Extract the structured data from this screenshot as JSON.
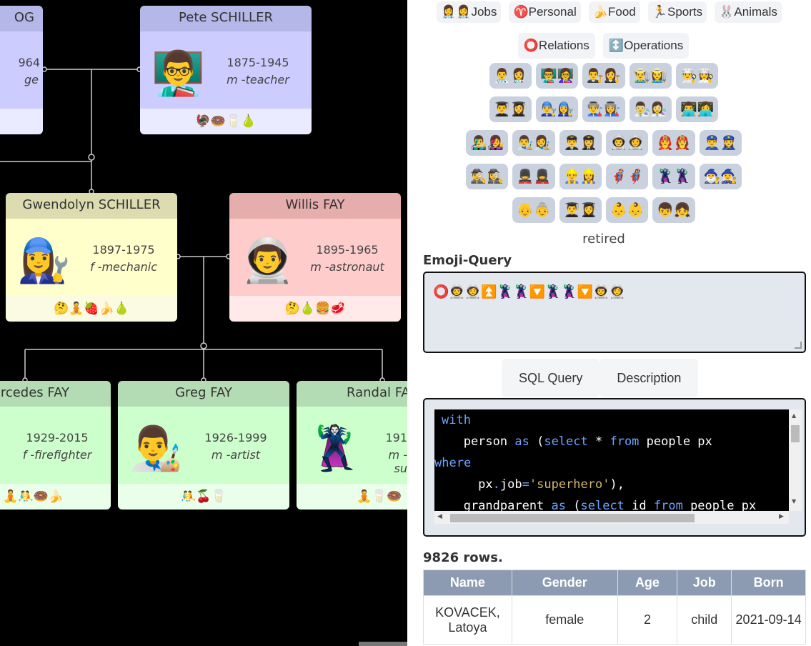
{
  "tree": {
    "cards": [
      {
        "id": "partial-top-left",
        "name": "OG",
        "years": "964",
        "role": "ge",
        "avatar": "",
        "foods": ""
      },
      {
        "id": "pete",
        "name": "Pete SCHILLER",
        "years": "1875-1945",
        "role": "m -teacher",
        "avatar": "👨‍🏫",
        "foods": "🦃🍩🥛🍐"
      },
      {
        "id": "gwendolyn",
        "name": "Gwendolyn SCHILLER",
        "years": "1897-1975",
        "role": "f -mechanic",
        "avatar": "👩‍🔧",
        "foods": "🤔🧘🍓🍌🍐"
      },
      {
        "id": "willis",
        "name": "Willis FAY",
        "years": "1895-1965",
        "role": "m -astronaut",
        "avatar": "👨‍🚀",
        "foods": "🤔🍐🍔🥩"
      },
      {
        "id": "mercedes",
        "name": "rcedes FAY",
        "years": "1929-2015",
        "role": "f -firefighter",
        "avatar": "",
        "foods": "🧘🤼🍩🍌"
      },
      {
        "id": "greg",
        "name": "Greg FAY",
        "years": "1926-1999",
        "role": "m -artist",
        "avatar": "👨‍🎨",
        "foods": "🤼🍒🥛"
      },
      {
        "id": "randal",
        "name": "Randal FA",
        "years": "191",
        "role": "m -su",
        "avatar": "🦹",
        "foods": "🧘🥛🍩"
      }
    ]
  },
  "categories": {
    "row1": [
      {
        "icon": "👩‍⚕️👩‍⚕️",
        "label": "Jobs"
      },
      {
        "icon": "♈",
        "label": "Personal"
      },
      {
        "icon": "🍌",
        "label": "Food"
      },
      {
        "icon": "🏃",
        "label": "Sports"
      },
      {
        "icon": "🐰",
        "label": "Animals"
      }
    ],
    "row2": [
      {
        "icon": "⭕",
        "label": "Relations"
      },
      {
        "icon": "↕️",
        "label": "Operations"
      }
    ]
  },
  "job_rows": [
    [
      "👨‍⚕️👩‍⚕️",
      "👨‍🏫👩‍🏫",
      "👨‍⚖️👩‍⚖️",
      "👨‍🌾👩‍🌾",
      "👨‍🍳👩‍🍳"
    ],
    [
      "👨‍🎓👩‍🎓",
      "👨‍🔧👩‍🔧",
      "👨‍🏭👩‍🏭",
      "👨‍🔬👩‍🔬",
      "👨‍💻👩‍💻"
    ],
    [
      "👨‍🎤👩‍🎤",
      "👨‍🎨👩‍🎨",
      "👨‍✈️👩‍✈️",
      "👨‍🚀👩‍🚀",
      "👨‍🚒👩‍🚒",
      "👮‍♂️👮‍♀️"
    ],
    [
      "🕵️‍♂️🕵️‍♀️",
      "💂‍♂️💂‍♀️",
      "👷‍♂️👷‍♀️",
      "🦸‍♂️🦸‍♀️",
      "🦹‍♂️🦹‍♀️",
      "🧙‍♂️🧙‍♀️"
    ],
    [
      "👴👵",
      "👨‍🎓👩‍🎓",
      "👶👶",
      "👦👧"
    ]
  ],
  "hover_label": "retired",
  "emoji_query": {
    "title": "Emoji-Query",
    "value": "⭕👨‍🚀👩‍🚀⏫🦹‍♂️🦹‍♀️🔽🦹‍♂️🦹‍♀️🔽👨‍🚀👩‍🚀"
  },
  "subtabs": [
    "SQL Query",
    "Description"
  ],
  "sql_lines": [
    [
      {
        "t": "with",
        "c": "kw"
      }
    ],
    [
      {
        "t": "   person "
      },
      {
        "t": "as",
        "c": "kw"
      },
      {
        "t": " ("
      },
      {
        "t": "select",
        "c": "kw"
      },
      {
        "t": " * "
      },
      {
        "t": "from",
        "c": "kw"
      },
      {
        "t": " people px"
      }
    ],
    [
      {
        "t": "where",
        "c": "kw"
      }
    ],
    [
      {
        "t": "     px"
      },
      {
        "t": ".",
        "c": "kw"
      },
      {
        "t": "job"
      },
      {
        "t": "=",
        "c": "kw"
      },
      {
        "t": "'superhero'",
        "c": "str"
      },
      {
        "t": "),"
      }
    ],
    [
      {
        "t": "   grandparent "
      },
      {
        "t": "as",
        "c": "kw"
      },
      {
        "t": " ("
      },
      {
        "t": "select",
        "c": "kw"
      },
      {
        "t": " id "
      },
      {
        "t": "from",
        "c": "kw"
      },
      {
        "t": " people px"
      }
    ]
  ],
  "result": {
    "count_text": "9826 rows.",
    "headers": [
      "Name",
      "Gender",
      "Age",
      "Job",
      "Born"
    ],
    "rows": [
      [
        "KOVACEK, Latoya",
        "female",
        "2",
        "child",
        "2021-09-14"
      ]
    ]
  }
}
